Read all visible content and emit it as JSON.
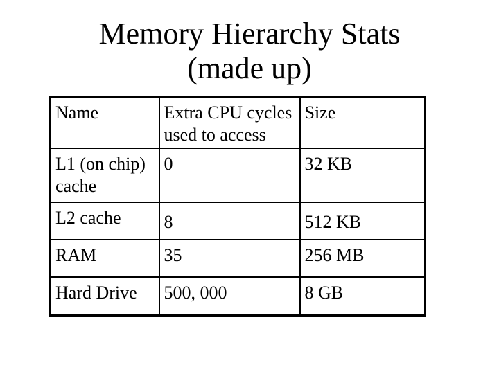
{
  "slide": {
    "title_line1": "Memory Hierarchy Stats",
    "title_line2": "(made up)"
  },
  "table": {
    "headers": [
      "Name",
      "Extra CPU cycles used to access",
      "Size"
    ],
    "rows": [
      [
        "L1 (on chip) cache",
        "0",
        "32 KB"
      ],
      [
        "L2 cache",
        "8",
        "512 KB"
      ],
      [
        "RAM",
        "35",
        "256 MB"
      ],
      [
        "Hard Drive",
        "500, 000",
        "8 GB"
      ]
    ]
  }
}
